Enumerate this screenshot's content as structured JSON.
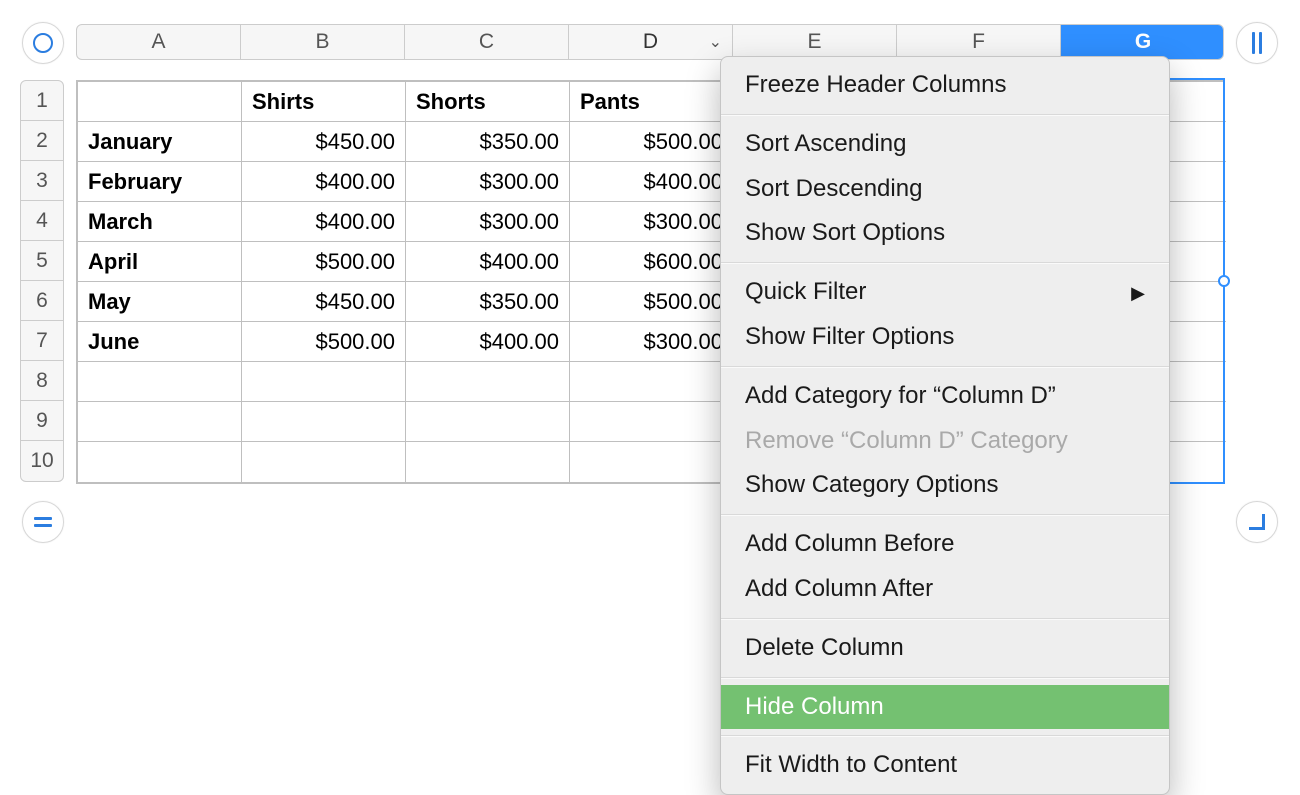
{
  "columns": {
    "letters": [
      "A",
      "B",
      "C",
      "D",
      "E",
      "F",
      "G"
    ],
    "widths": [
      164,
      164,
      164,
      164,
      164,
      164,
      164
    ],
    "active_index": 3,
    "selected_index": 6
  },
  "rows": {
    "numbers": [
      "1",
      "2",
      "3",
      "4",
      "5",
      "6",
      "7",
      "8",
      "9",
      "10"
    ]
  },
  "table": {
    "header": [
      "",
      "Shirts",
      "Shorts",
      "Pants",
      "",
      "",
      ""
    ],
    "body": [
      [
        "January",
        "$450.00",
        "$350.00",
        "$500.00",
        "",
        "",
        ""
      ],
      [
        "February",
        "$400.00",
        "$300.00",
        "$400.00",
        "",
        "",
        ""
      ],
      [
        "March",
        "$400.00",
        "$300.00",
        "$300.00",
        "",
        "",
        ""
      ],
      [
        "April",
        "$500.00",
        "$400.00",
        "$600.00",
        "",
        "",
        ""
      ],
      [
        "May",
        "$450.00",
        "$350.00",
        "$500.00",
        "",
        "",
        ""
      ],
      [
        "June",
        "$500.00",
        "$400.00",
        "$300.00",
        "",
        "",
        ""
      ],
      [
        "",
        "",
        "",
        "",
        "",
        "",
        ""
      ],
      [
        "",
        "",
        "",
        "",
        "",
        "",
        ""
      ],
      [
        "",
        "",
        "",
        "",
        "",
        "",
        ""
      ]
    ]
  },
  "context_menu": {
    "groups": [
      [
        {
          "label": "Freeze Header Columns"
        }
      ],
      [
        {
          "label": "Sort Ascending"
        },
        {
          "label": "Sort Descending"
        },
        {
          "label": "Show Sort Options"
        }
      ],
      [
        {
          "label": "Quick Filter",
          "submenu": true
        },
        {
          "label": "Show Filter Options"
        }
      ],
      [
        {
          "label": "Add Category for “Column D”"
        },
        {
          "label": "Remove “Column D” Category",
          "disabled": true
        },
        {
          "label": "Show Category Options"
        }
      ],
      [
        {
          "label": "Add Column Before"
        },
        {
          "label": "Add Column After"
        }
      ],
      [
        {
          "label": "Delete Column"
        }
      ],
      [
        {
          "label": "Hide Column",
          "highlight": true
        }
      ],
      [
        {
          "label": "Fit Width to Content"
        }
      ]
    ]
  }
}
